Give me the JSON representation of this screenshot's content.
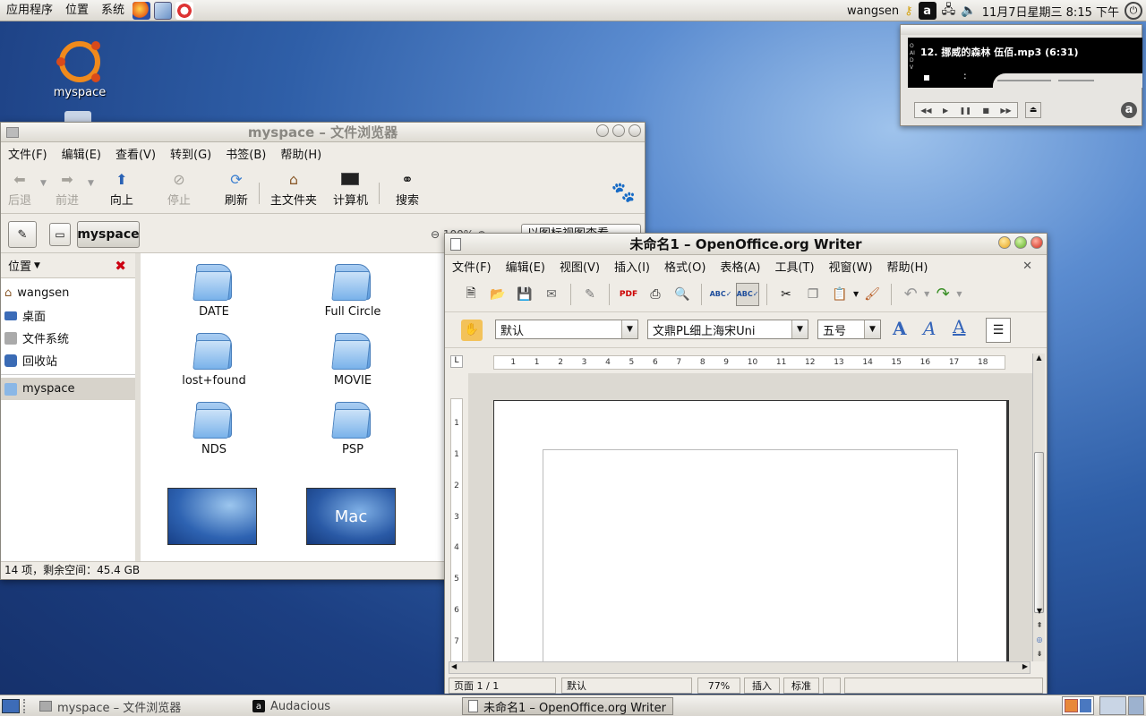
{
  "top_panel": {
    "menus": [
      "应用程序",
      "位置",
      "系统"
    ],
    "user": "wangsen",
    "datetime": "11月7日星期三  8:15 下午"
  },
  "desktop": {
    "icons": [
      {
        "label": "myspace"
      }
    ]
  },
  "audacious": {
    "track": "12. 挪威的森林 伍佰.mp3 (6:31)",
    "side_label": "OAIDV",
    "time": ":"
  },
  "file_browser": {
    "title": "myspace – 文件浏览器",
    "menus": [
      "文件(F)",
      "编辑(E)",
      "查看(V)",
      "转到(G)",
      "书签(B)",
      "帮助(H)"
    ],
    "toolbar": [
      "后退",
      "前进",
      "向上",
      "停止",
      "刷新",
      "主文件夹",
      "计算机",
      "搜索"
    ],
    "location": "myspace",
    "zoom": "100%",
    "view_mode": "以图标视图查看",
    "sidebar_title": "位置",
    "places": [
      "wangsen",
      "桌面",
      "文件系统",
      "回收站",
      "myspace"
    ],
    "files": [
      "DATE",
      "Full Circle",
      "lost+found",
      "MOVIE",
      "NDS",
      "PSP"
    ],
    "thumb_text": "Mac",
    "status": "14 项，剩余空间：45.4 GB"
  },
  "writer": {
    "title": "未命名1 – OpenOffice.org Writer",
    "menus": [
      "文件(F)",
      "编辑(E)",
      "视图(V)",
      "插入(I)",
      "格式(O)",
      "表格(A)",
      "工具(T)",
      "视窗(W)",
      "帮助(H)"
    ],
    "style": "默认",
    "font": "文鼎PL细上海宋Uni",
    "size": "五号",
    "ruler": [
      "1",
      "1",
      "2",
      "3",
      "4",
      "5",
      "6",
      "7",
      "8",
      "9",
      "10",
      "11",
      "12",
      "13",
      "14",
      "15",
      "16",
      "17",
      "18"
    ],
    "vruler": [
      "1",
      "1",
      "2",
      "3",
      "4",
      "5",
      "6",
      "7"
    ],
    "status": {
      "page": "页面 1 / 1",
      "style": "默认",
      "zoom": "77%",
      "mode": "插入",
      "sel": "标准"
    }
  },
  "taskbar": {
    "tasks": [
      "myspace – 文件浏览器",
      "Audacious",
      "未命名1 – OpenOffice.org Writer"
    ]
  }
}
